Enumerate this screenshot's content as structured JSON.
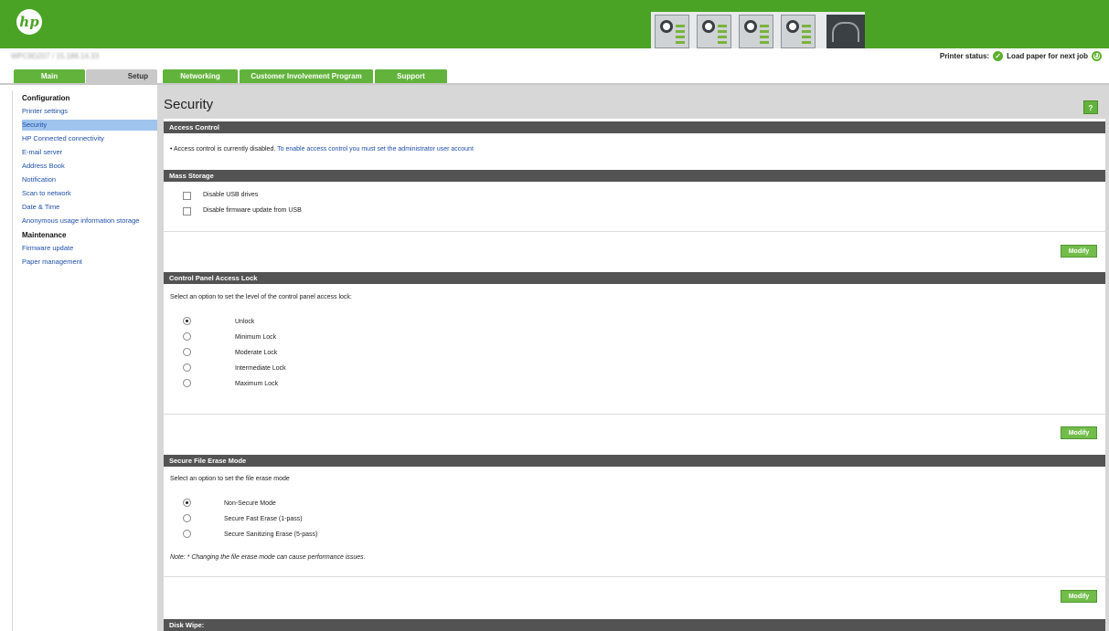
{
  "header": {
    "logo_text": "hp",
    "device_line": "WPC9DZ07 / 15.188.14.33"
  },
  "status": {
    "label": "Printer status:",
    "ok_glyph": "✓",
    "message": "Load paper for next job",
    "refresh_glyph": "↻"
  },
  "tabs": [
    {
      "label": "Main"
    },
    {
      "label": "Setup"
    },
    {
      "label": "Networking"
    },
    {
      "label": "Customer Involvement Program"
    },
    {
      "label": "Support"
    }
  ],
  "sidebar": {
    "configuration_heading": "Configuration",
    "maintenance_heading": "Maintenance",
    "items": [
      {
        "label": "Printer settings"
      },
      {
        "label": "Security"
      },
      {
        "label": "HP Connected connectivity"
      },
      {
        "label": "E-mail server"
      },
      {
        "label": "Address Book"
      },
      {
        "label": "Notification"
      },
      {
        "label": "Scan to network"
      },
      {
        "label": "Date & Time"
      },
      {
        "label": "Anonymous usage information storage"
      },
      {
        "label": "Firmware update"
      },
      {
        "label": "Paper management"
      }
    ]
  },
  "page": {
    "title": "Security",
    "help_label": "?"
  },
  "access_control": {
    "heading": "Access Control",
    "text": "Access control is currently disabled.",
    "link": "To enable access control you must set the administrator user account"
  },
  "mass_storage": {
    "heading": "Mass Storage",
    "options": [
      "Disable USB drives",
      "Disable firmware update from USB"
    ],
    "modify_label": "Modify"
  },
  "control_panel": {
    "heading": "Control Panel Access Lock",
    "prompt": "Select an option to set the level of the control panel access lock:",
    "options": [
      "Unlock",
      "Minimum Lock",
      "Moderate Lock",
      "Intermediate Lock",
      "Maximum Lock"
    ],
    "selected": "Unlock",
    "modify_label": "Modify"
  },
  "file_erase": {
    "heading": "Secure File Erase Mode",
    "prompt": "Select an option to set the file erase mode",
    "options": [
      "Non-Secure Mode",
      "Secure Fast Erase (1-pass)",
      "Secure Sanitizing Erase (5-pass)"
    ],
    "selected": "Non-Secure Mode",
    "note": "Note: * Changing the file erase mode can cause performance issues.",
    "modify_label": "Modify"
  },
  "disk_wipe": {
    "heading": "Disk Wipe:"
  },
  "colors": {
    "hp_green": "#4aa324",
    "section_bar": "#535353",
    "link_blue": "#1f4fa8"
  }
}
